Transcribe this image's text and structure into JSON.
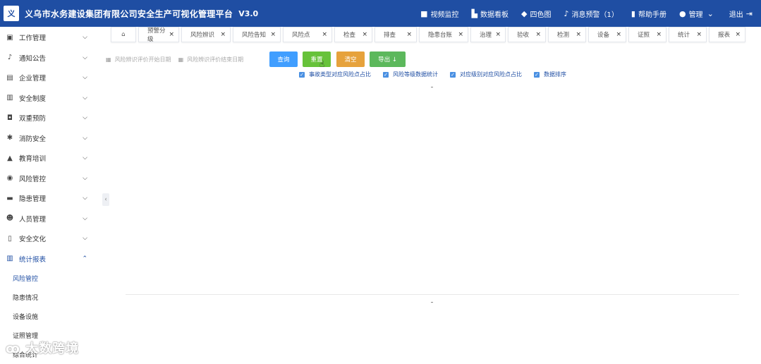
{
  "header": {
    "logo_text": "义",
    "title": "义乌市水务建设集团有限公司安全生产可视化管理平台",
    "version": "V3.0",
    "actions": [
      {
        "label": "视频监控",
        "icon": "video-icon"
      },
      {
        "label": "数据看板",
        "icon": "chart-board-icon"
      },
      {
        "label": "四色图",
        "icon": "cube-icon"
      },
      {
        "label": "消息预警（1）",
        "icon": "bell-icon"
      },
      {
        "label": "帮助手册",
        "icon": "book-icon"
      },
      {
        "label": "管理",
        "icon": "user-icon"
      },
      {
        "label": "退出",
        "icon": "logout-icon"
      }
    ]
  },
  "sidebar": {
    "items": [
      {
        "label": "工作管理",
        "icon": "clipboard-icon"
      },
      {
        "label": "通知公告",
        "icon": "bell-icon"
      },
      {
        "label": "企业管理",
        "icon": "building-icon"
      },
      {
        "label": "安全制度",
        "icon": "bank-icon"
      },
      {
        "label": "双重预防",
        "icon": "shield-icon"
      },
      {
        "label": "消防安全",
        "icon": "gear-icon"
      },
      {
        "label": "教育培训",
        "icon": "graduation-icon"
      },
      {
        "label": "风险管控",
        "icon": "target-icon"
      },
      {
        "label": "隐患管理",
        "icon": "screen-icon"
      },
      {
        "label": "人员管理",
        "icon": "person-icon"
      },
      {
        "label": "安全文化",
        "icon": "book-icon"
      },
      {
        "label": "统计报表",
        "icon": "bar-chart-icon"
      }
    ],
    "sub_items": [
      "风险管控",
      "隐患情况",
      "设备设施",
      "证照管理",
      "综合统计"
    ]
  },
  "tabs": [
    {
      "label": "",
      "home": true
    },
    {
      "label": "预警分级"
    },
    {
      "label": "风险辨识"
    },
    {
      "label": "风险告知"
    },
    {
      "label": "风险点"
    },
    {
      "label": "检查"
    },
    {
      "label": "排查"
    },
    {
      "label": "隐患台账"
    },
    {
      "label": "治理"
    },
    {
      "label": "验收"
    },
    {
      "label": "检测"
    },
    {
      "label": "设备"
    },
    {
      "label": "证照"
    },
    {
      "label": "统计"
    },
    {
      "label": "报表"
    }
  ],
  "filters": {
    "start_placeholder": "风险辨识评价开始日期",
    "end_placeholder": "风险辨识评价结束日期"
  },
  "buttons": {
    "query": "查询",
    "reset": "重置",
    "clear": "清空",
    "export": "导出 ↓"
  },
  "checks": [
    "事故类型对应风险点占比",
    "风险等级数据统计",
    "对应级别对应风险点占比",
    "数据排序"
  ],
  "watermark": "大数跨境",
  "colors": {
    "header": "#1f4ea3",
    "query": "#409eff",
    "reset": "#67c23a",
    "clear": "#e6a23c",
    "export": "#5cb85c"
  }
}
